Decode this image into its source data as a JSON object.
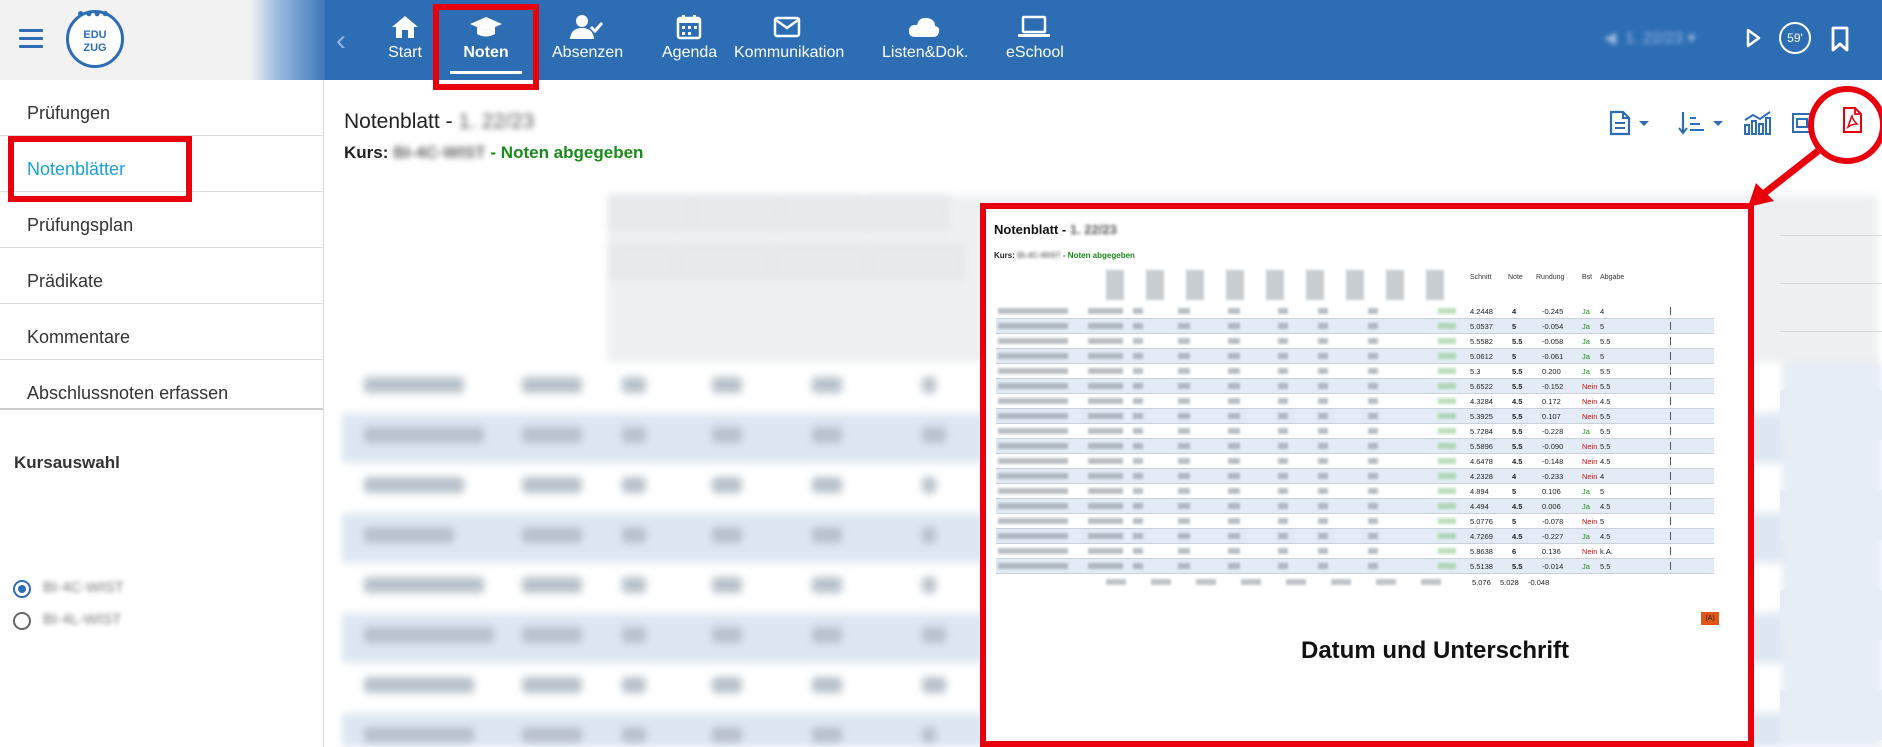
{
  "brand": {
    "logo_text_top": "EDU",
    "logo_text_bottom": "ZUG"
  },
  "nav": {
    "items": [
      {
        "label": "Start",
        "icon": "home-icon"
      },
      {
        "label": "Noten",
        "icon": "graduation-cap-icon",
        "active": true
      },
      {
        "label": "Absenzen",
        "icon": "user-check-icon"
      },
      {
        "label": "Agenda",
        "icon": "calendar-icon"
      },
      {
        "label": "Kommunikation",
        "icon": "envelope-icon"
      },
      {
        "label": "Listen&Dok.",
        "icon": "cloud-icon"
      },
      {
        "label": "eSchool",
        "icon": "laptop-icon"
      }
    ],
    "term": "1. 22/23",
    "timer": "59'"
  },
  "sidebar": {
    "items": [
      {
        "label": "Prüfungen"
      },
      {
        "label": "Notenblätter",
        "active": true
      },
      {
        "label": "Prüfungsplan"
      },
      {
        "label": "Prädikate"
      },
      {
        "label": "Kommentare"
      },
      {
        "label": "Abschlussnoten erfassen"
      }
    ],
    "kursauswahl_label": "Kursauswahl",
    "courses": [
      {
        "label": "BI-4C-WIST",
        "checked": true
      },
      {
        "label": "BI-4L-WIST",
        "checked": false
      }
    ]
  },
  "main": {
    "title": "Notenblatt - ",
    "title_term": "1. 22/23",
    "kurs_label": "Kurs:",
    "kurs_value": "BI-4C-WIST",
    "status": " - Noten abgegeben"
  },
  "preview": {
    "title": "Notenblatt",
    "title_term": "1. 22/23",
    "kurs_label": "Kurs:",
    "kurs_value": "BI-4C-WIST",
    "status": " - Noten abgegeben",
    "headers": {
      "schnitt": "Schnitt",
      "note": "Note",
      "rundung": "Rundung",
      "bst": "Bst",
      "abgabe": "Abgabe"
    },
    "rows": [
      {
        "schnitt": "4.2448",
        "note": "4",
        "rundung": "-0.245",
        "bst": "Ja",
        "abgabe": "4"
      },
      {
        "schnitt": "5.0537",
        "note": "5",
        "rundung": "-0.054",
        "bst": "Ja",
        "abgabe": "5"
      },
      {
        "schnitt": "5.5582",
        "note": "5.5",
        "rundung": "-0.058",
        "bst": "Ja",
        "abgabe": "5.5"
      },
      {
        "schnitt": "5.0612",
        "note": "5",
        "rundung": "-0.061",
        "bst": "Ja",
        "abgabe": "5"
      },
      {
        "schnitt": "5.3",
        "note": "5.5",
        "rundung": "0.200",
        "bst": "Ja",
        "abgabe": "5.5"
      },
      {
        "schnitt": "5.6522",
        "note": "5.5",
        "rundung": "-0.152",
        "bst": "Nein",
        "abgabe": "5.5"
      },
      {
        "schnitt": "4.3284",
        "note": "4.5",
        "rundung": "0.172",
        "bst": "Nein",
        "abgabe": "4.5"
      },
      {
        "schnitt": "5.3925",
        "note": "5.5",
        "rundung": "0.107",
        "bst": "Nein",
        "abgabe": "5.5"
      },
      {
        "schnitt": "5.7284",
        "note": "5.5",
        "rundung": "-0.228",
        "bst": "Ja",
        "abgabe": "5.5"
      },
      {
        "schnitt": "5.5896",
        "note": "5.5",
        "rundung": "-0.090",
        "bst": "Nein",
        "abgabe": "5.5"
      },
      {
        "schnitt": "4.6478",
        "note": "4.5",
        "rundung": "-0.148",
        "bst": "Nein",
        "abgabe": "4.5"
      },
      {
        "schnitt": "4.2328",
        "note": "4",
        "rundung": "-0.233",
        "bst": "Nein",
        "abgabe": "4"
      },
      {
        "schnitt": "4.894",
        "note": "5",
        "rundung": "0.106",
        "bst": "Ja",
        "abgabe": "5"
      },
      {
        "schnitt": "4.494",
        "note": "4.5",
        "rundung": "0.006",
        "bst": "Ja",
        "abgabe": "4.5"
      },
      {
        "schnitt": "5.0776",
        "note": "5",
        "rundung": "-0.078",
        "bst": "Nein",
        "abgabe": "5"
      },
      {
        "schnitt": "4.7269",
        "note": "4.5",
        "rundung": "-0.227",
        "bst": "Ja",
        "abgabe": "4.5"
      },
      {
        "schnitt": "5.8638",
        "note": "6",
        "rundung": "0.136",
        "bst": "Nein",
        "abgabe": "k.A."
      },
      {
        "schnitt": "5.5138",
        "note": "5.5",
        "rundung": "-0.014",
        "bst": "Ja",
        "abgabe": "5.5"
      }
    ],
    "totals": {
      "schnitt": "5.076",
      "note": "5.028",
      "rundung": "-0.048"
    },
    "warning_badge": "(A)",
    "signature_label": "Datum und Unterschrift"
  },
  "colors": {
    "nav_blue": "#2c6db4",
    "active_link": "#1aa1d8",
    "ok_green": "#1a8a1a",
    "annotation_red": "#e8000c"
  }
}
